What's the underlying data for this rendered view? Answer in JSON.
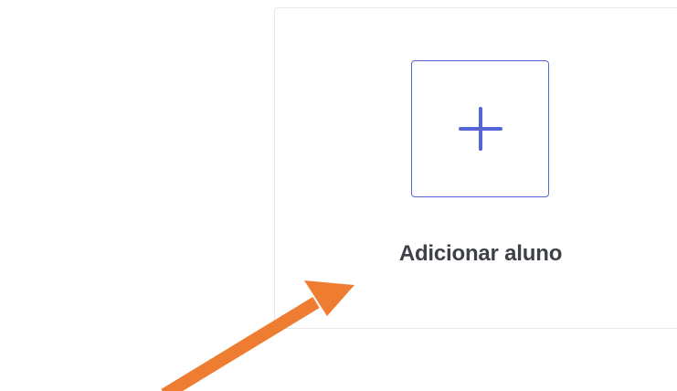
{
  "card": {
    "label": "Adicionar aluno",
    "action_icon": "plus-icon",
    "accent_color": "#5565d6",
    "label_color": "#3e4248",
    "border_color": "#e6e7ea"
  },
  "annotation": {
    "icon": "arrow-annotation",
    "color": "#ef7d31"
  }
}
